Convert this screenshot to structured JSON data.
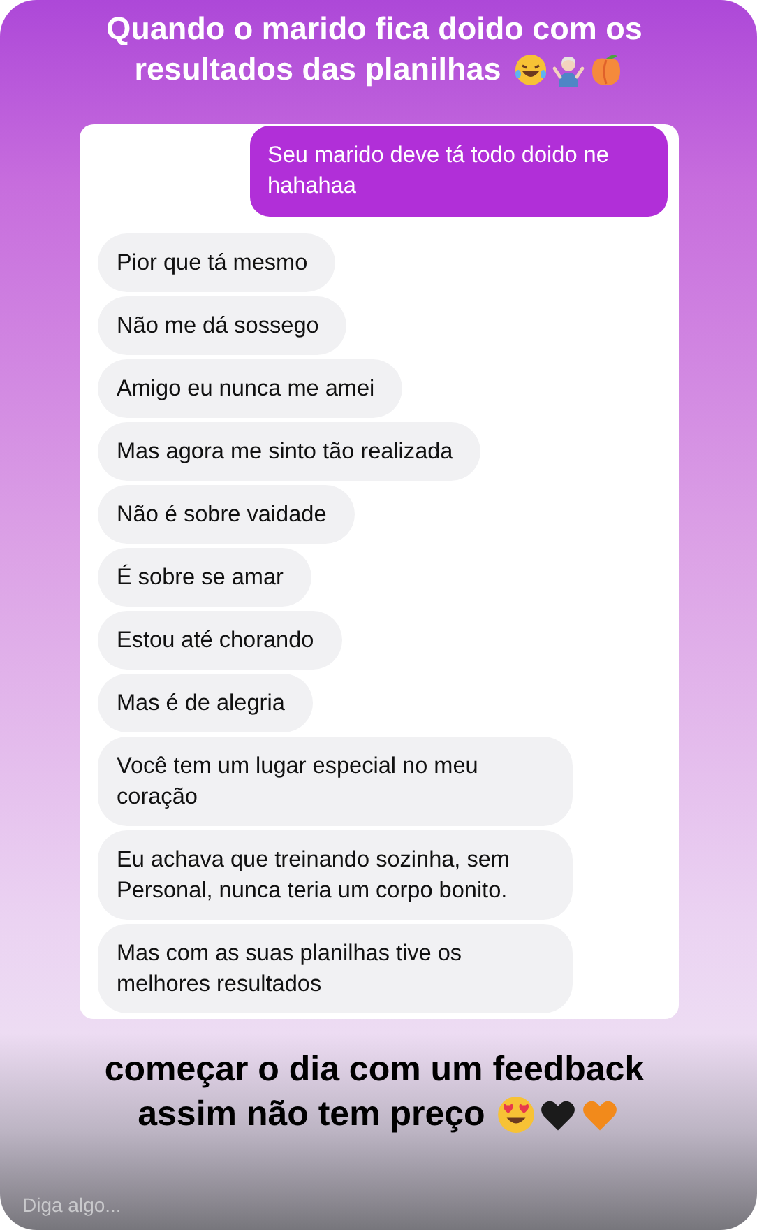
{
  "title": {
    "lines": [
      "Quando o marido fica doido com os",
      "resultados das planilhas"
    ]
  },
  "chat": {
    "messages": [
      {
        "kind": "sent",
        "text": "Seu marido deve tá todo doido ne hahahaa"
      },
      {
        "kind": "received",
        "text": "Pior que tá mesmo"
      },
      {
        "kind": "received",
        "text": "Não me dá sossego"
      },
      {
        "kind": "received",
        "text": "Amigo eu nunca me amei"
      },
      {
        "kind": "received",
        "text": "Mas agora me sinto tão realizada"
      },
      {
        "kind": "received",
        "text": "Não é sobre vaidade"
      },
      {
        "kind": "received",
        "text": "É sobre se amar"
      },
      {
        "kind": "received",
        "text": "Estou até chorando"
      },
      {
        "kind": "received",
        "text": "Mas é de alegria"
      },
      {
        "kind": "received",
        "text": "Você tem um lugar especial no meu coração"
      },
      {
        "kind": "received",
        "text": "Eu achava que treinando sozinha, sem Personal,  nunca teria um corpo bonito."
      },
      {
        "kind": "received",
        "text": "Mas com as suas planilhas tive os melhores resultados"
      }
    ]
  },
  "caption": {
    "lines": [
      "começar o dia com um feedback",
      "assim não tem preço"
    ]
  },
  "reply_field": {
    "placeholder": "Diga algo..."
  }
}
